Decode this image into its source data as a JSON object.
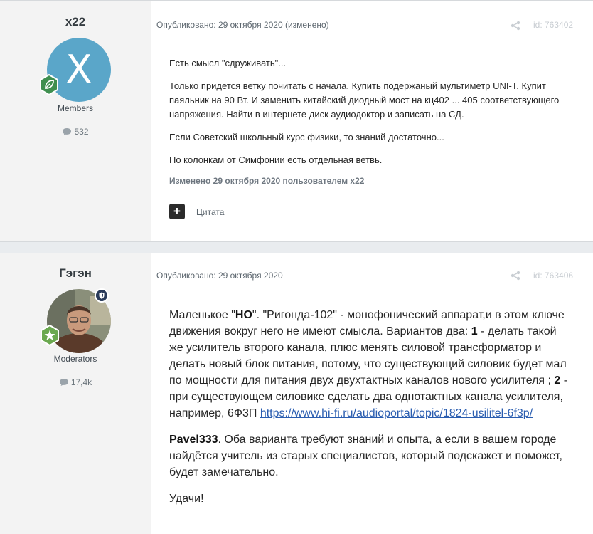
{
  "posts": [
    {
      "author": "x22",
      "avatar_letter": "X",
      "group": "Members",
      "post_count": "532",
      "meta": "Опубликовано: 29 октября 2020 (изменено)",
      "post_id": "id: 763402",
      "paragraphs": [
        "Есть смысл \"сдруживать\"...",
        "Только придется ветку почитать с начала. Купить подержаный мультиметр UNI-T. Купит паяльник на 90 Вт. И заменить китайский диодный мост на кц402 ... 405 соответствующего напряжения. Найти в интернете диск аудиодоктор и записать на СД.",
        "Если Советский школьный курс физики, то знаний достаточно...",
        "По колонкам от Симфонии есть отдельная ветвь."
      ],
      "edited_note": "Изменено 29 октября 2020 пользователем x22",
      "quote_label": "Цитата"
    },
    {
      "author": "Гэгэн",
      "group": "Moderators",
      "post_count": "17,4k",
      "meta": "Опубликовано: 29 октября 2020",
      "post_id": "id: 763406",
      "p1_a": "Маленькое \"",
      "p1_b": "НО",
      "p1_c": "\".  \"Ригонда-102\" - монофонический аппарат,и  в этом ключе движения вокруг него не имеют смысла.  Вариантов два: ",
      "p1_d": "1",
      "p1_e": " - делать такой же усилитель второго канала, плюс менять силовой трансформатор и делать новый блок питания, потому, что существующий силовик  будет мал по мощности для питания двух двухтактных каналов нового усилителя ; ",
      "p1_f": "2",
      "p1_g": " - при существующем силовике сделать два однотактных канала усилителя, например, 6Ф3П  ",
      "p1_link": "https://www.hi-fi.ru/audioportal/topic/1824-usilitel-6f3p/",
      "p2_mention": "Pavel333",
      "p2_text": ". Оба варианта требуют знаний и опыта, а если в вашем городе найдётся учитель из старых специалистов, который подскажет и поможет, будет замечательно.",
      "p3": "Удачи!"
    }
  ],
  "colors": {
    "avatar_bg": "#5aa6c9",
    "rank_badge_members": "#3f8f4f",
    "rank_badge_moderators": "#6aa84f",
    "mod_badge": "#2a3b5a",
    "link": "#2a5db0"
  },
  "icons": [
    "leaf-icon",
    "star-icon",
    "shield-icon",
    "comment-icon",
    "share-icon",
    "plus-icon"
  ]
}
